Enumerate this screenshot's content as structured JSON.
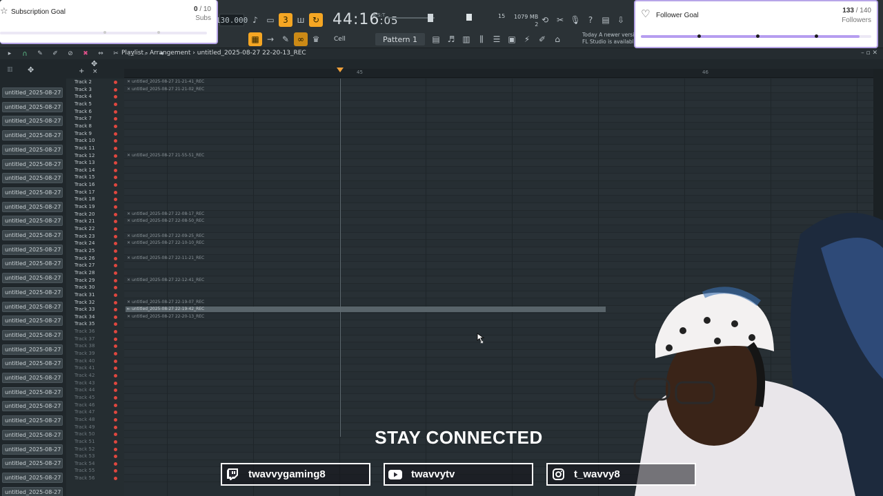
{
  "toolbar": {
    "tempo": "130.000",
    "time": "44:16",
    "time_frac": ":05",
    "time_unit": "B:S:T",
    "cpu": "15",
    "memory": "1079 MB",
    "poly": "2",
    "snap": "Cell",
    "pattern": "Pattern 1",
    "news_line1": "Today  A newer version",
    "news_line2": "FL Studio is available!"
  },
  "subscription_goal": {
    "title": "Subscription Goal",
    "current": "0",
    "target": "/ 10",
    "unit": "Subs",
    "progress": 0.0
  },
  "follower_goal": {
    "title": "Follower Goal",
    "current": "133",
    "target": "/ 140",
    "unit": "Followers",
    "progress": 0.95
  },
  "playlist": {
    "title": "Playlist - Arrangement",
    "separator": "›",
    "project": "untitled_2025-08-27 22-20-13_REC",
    "ruler": [
      "45",
      "46"
    ]
  },
  "patterns": [
    "untitled_2025-08-27 21-...",
    "untitled_2025-08-27 21-...",
    "untitled_2025-08-27 21-...",
    "untitled_2025-08-27 21-...",
    "untitled_2025-08-27 21-...",
    "untitled_2025-08-27 21-...",
    "untitled_2025-08-27 22-...",
    "untitled_2025-08-27 22-...",
    "untitled_2025-08-27 22-...",
    "untitled_2025-08-27 22-...",
    "untitled_2025-08-27 22-...",
    "untitled_2025-08-27 22-...",
    "untitled_2025-08-27 22-...",
    "untitled_2025-08-27 22-...",
    "untitled_2025-08-27 22-...",
    "untitled_2025-08-27 22-...",
    "untitled_2025-08-27 22-...",
    "untitled_2025-08-27 22-...",
    "untitled_2025-08-27 22-...",
    "untitled_2025-08-27 22-...",
    "untitled_2025-08-27 22-...",
    "untitled_2025-08-27 22-...",
    "untitled_2025-08-27 22-...",
    "untitled_2025-08-27 22-...",
    "untitled_2025-08-27 22-...",
    "untitled_2025-08-27 22-...",
    "untitled_2025-08-27 22-...",
    "untitled_2025-08-27 22-...",
    "untitled_2025-08-27 22-...",
    "untitled_2025-08-27 22-..."
  ],
  "tracks": [
    "Track 2",
    "Track 3",
    "Track 4",
    "Track 5",
    "Track 6",
    "Track 7",
    "Track 8",
    "Track 9",
    "Track 10",
    "Track 11",
    "Track 12",
    "Track 13",
    "Track 14",
    "Track 15",
    "Track 16",
    "Track 17",
    "Track 18",
    "Track 19",
    "Track 20",
    "Track 21",
    "Track 22",
    "Track 23",
    "Track 24",
    "Track 25",
    "Track 26",
    "Track 27",
    "Track 28",
    "Track 29",
    "Track 30",
    "Track 31",
    "Track 32",
    "Track 33",
    "Track 34",
    "Track 35",
    "Track 36",
    "Track 37",
    "Track 38",
    "Track 39",
    "Track 40",
    "Track 41",
    "Track 42",
    "Track 43",
    "Track 44",
    "Track 45",
    "Track 46",
    "Track 47",
    "Track 48",
    "Track 49",
    "Track 50",
    "Track 51",
    "Track 52",
    "Track 53",
    "Track 54",
    "Track 55",
    "Track 56"
  ],
  "clips": [
    {
      "track": 0,
      "label": "untitled_2025-08-27 21-21-41_REC"
    },
    {
      "track": 1,
      "label": "untitled_2025-08-27 21-21-02_REC"
    },
    {
      "track": 10,
      "label": "untitled_2025-08-27 21-55-51_REC"
    },
    {
      "track": 18,
      "label": "untitled_2025-08-27 22-08-17_REC"
    },
    {
      "track": 19,
      "label": "untitled_2025-08-27 22-08-50_REC"
    },
    {
      "track": 21,
      "label": "untitled_2025-08-27 22-09-25_REC"
    },
    {
      "track": 22,
      "label": "untitled_2025-08-27 22-10-10_REC"
    },
    {
      "track": 24,
      "label": "untitled_2025-08-27 22-11-21_REC"
    },
    {
      "track": 27,
      "label": "untitled_2025-08-27 22-12-41_REC"
    },
    {
      "track": 30,
      "label": "untitled_2025-08-27 22-19-07_REC"
    },
    {
      "track": 31,
      "label": "untitled_2025-08-27 22-19-42_REC",
      "bright": true
    },
    {
      "track": 32,
      "label": "untitled_2025-08-27 22-20-13_REC"
    }
  ],
  "overlay": {
    "stay_connected": "STAY CONNECTED",
    "socials": [
      {
        "icon": "twitch-icon",
        "label": "twavvygaming8"
      },
      {
        "icon": "youtube-icon",
        "label": "twavvytv"
      },
      {
        "icon": "instagram-icon",
        "label": "t_wavvy8"
      }
    ]
  }
}
